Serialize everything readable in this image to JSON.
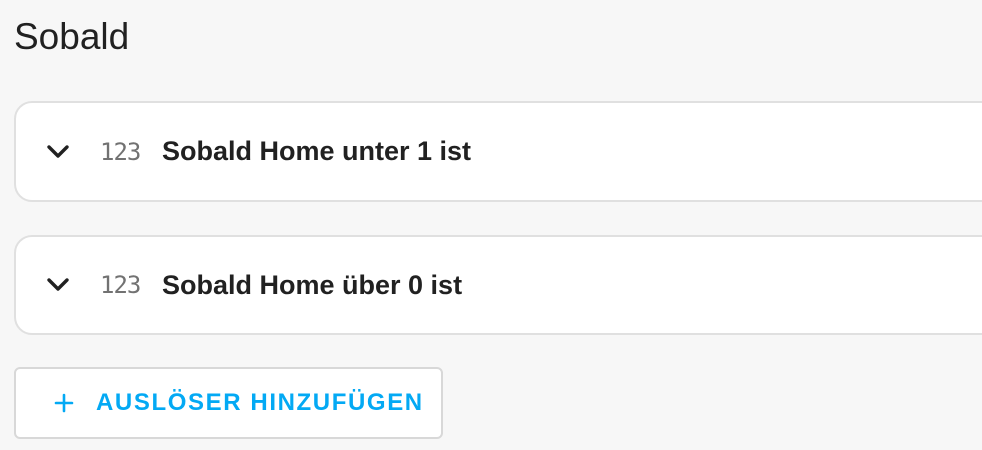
{
  "section": {
    "title": "Sobald"
  },
  "triggers": [
    {
      "type_icon": "123",
      "icon_name": "numeric-icon",
      "label": "Sobald Home unter 1 ist"
    },
    {
      "type_icon": "123",
      "icon_name": "numeric-icon",
      "label": "Sobald Home über 0 ist"
    }
  ],
  "add_button": {
    "icon": "plus-icon",
    "label": "AUSLÖSER HINZUFÜGEN"
  },
  "colors": {
    "accent": "#03a9f4",
    "background": "#f7f7f7",
    "card": "#ffffff",
    "text": "#212121",
    "icon_muted": "#727272"
  }
}
